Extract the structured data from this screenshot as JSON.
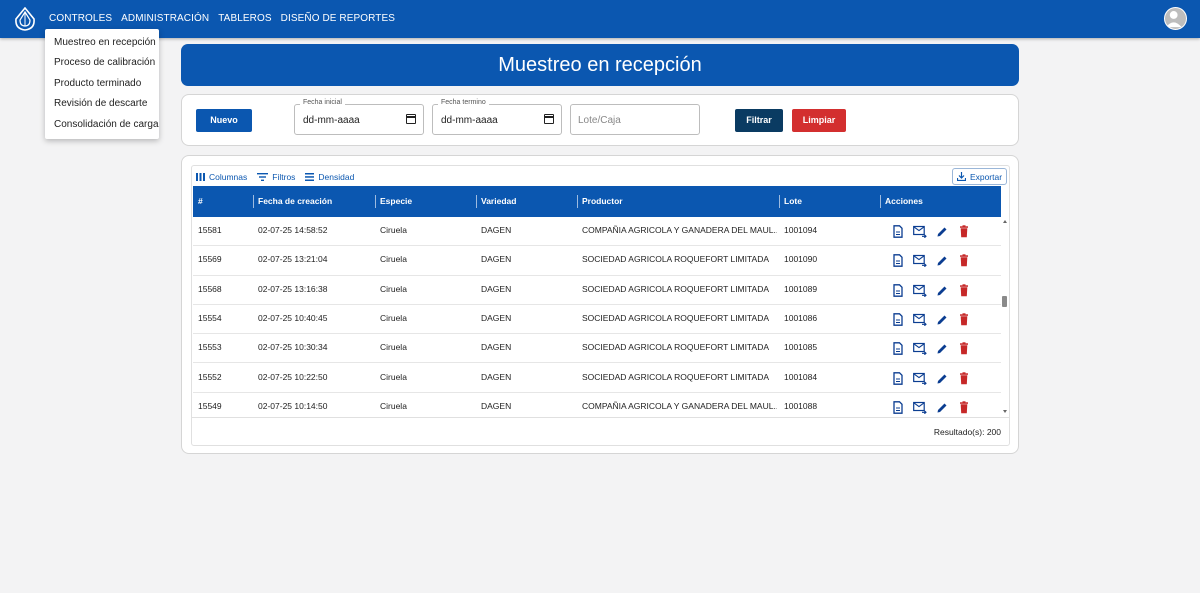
{
  "nav": {
    "items": [
      "CONTROLES",
      "ADMINISTRACIÓN",
      "TABLEROS",
      "DISEÑO DE REPORTES"
    ]
  },
  "menu": {
    "items": [
      "Muestreo en recepción",
      "Proceso de calibración",
      "Producto terminado",
      "Revisión de descarte",
      "Consolidación de carga"
    ]
  },
  "page": {
    "title": "Muestreo en recepción"
  },
  "filters": {
    "new_label": "Nuevo",
    "fecha_inicial_label": "Fecha inicial",
    "fecha_inicial_value": "dd-mm-aaaa",
    "fecha_termino_label": "Fecha termino",
    "fecha_termino_value": "dd-mm-aaaa",
    "lote_placeholder": "Lote/Caja",
    "filter_label": "Filtrar",
    "clear_label": "Limpiar"
  },
  "toolbar": {
    "columns": "Columnas",
    "filters": "Filtros",
    "density": "Densidad",
    "export": "Exportar"
  },
  "table": {
    "headers": [
      "#",
      "Fecha de creación",
      "Especie",
      "Variedad",
      "Productor",
      "Lote",
      "Acciones"
    ],
    "rows": [
      [
        "15581",
        "02-07-25 14:58:52",
        "Ciruela",
        "DAGEN",
        "COMPAÑIA AGRICOLA Y GANADERA DEL MAUL...",
        "1001094"
      ],
      [
        "15569",
        "02-07-25 13:21:04",
        "Ciruela",
        "DAGEN",
        "SOCIEDAD AGRICOLA ROQUEFORT LIMITADA",
        "1001090"
      ],
      [
        "15568",
        "02-07-25 13:16:38",
        "Ciruela",
        "DAGEN",
        "SOCIEDAD AGRICOLA ROQUEFORT LIMITADA",
        "1001089"
      ],
      [
        "15554",
        "02-07-25 10:40:45",
        "Ciruela",
        "DAGEN",
        "SOCIEDAD AGRICOLA ROQUEFORT LIMITADA",
        "1001086"
      ],
      [
        "15553",
        "02-07-25 10:30:34",
        "Ciruela",
        "DAGEN",
        "SOCIEDAD AGRICOLA ROQUEFORT LIMITADA",
        "1001085"
      ],
      [
        "15552",
        "02-07-25 10:22:50",
        "Ciruela",
        "DAGEN",
        "SOCIEDAD AGRICOLA ROQUEFORT LIMITADA",
        "1001084"
      ],
      [
        "15549",
        "02-07-25 10:14:50",
        "Ciruela",
        "DAGEN",
        "COMPAÑIA AGRICOLA Y GANADERA DEL MAUL...",
        "1001088"
      ]
    ],
    "results": "Resultado(s): 200"
  },
  "colors": {
    "primary": "#0b57b0",
    "dark_button": "#0a3b62",
    "danger": "#d32f2f",
    "delete_icon": "#c62828"
  },
  "icons": {
    "logo": "drop-logo-icon",
    "avatar": "user-avatar-icon",
    "actions": [
      "document-icon",
      "email-send-icon",
      "edit-pencil-icon",
      "delete-trash-icon"
    ]
  }
}
